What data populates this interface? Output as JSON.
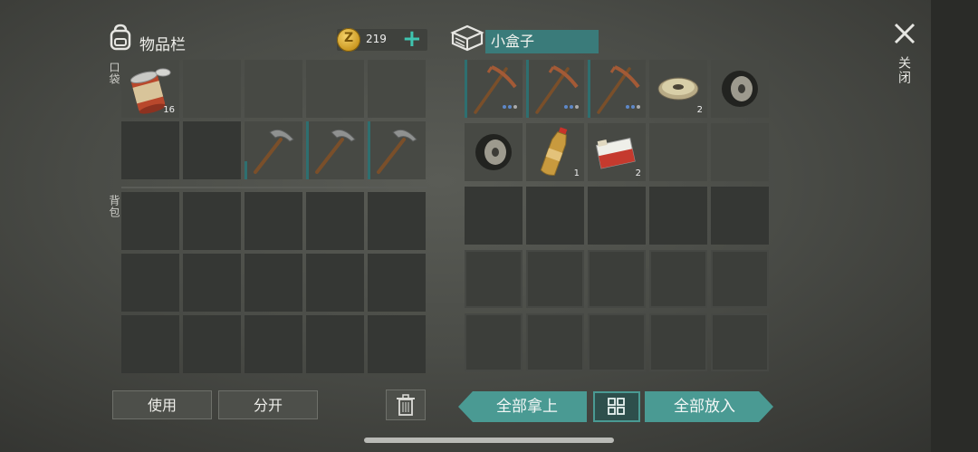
{
  "inventory": {
    "title": "物品栏",
    "pocket_label": "口袋",
    "backpack_label": "背包",
    "coins": "219",
    "coin_symbol": "Z",
    "add_coin": "+",
    "pocket_slots": [
      {
        "item": "canned-food",
        "qty": "16"
      },
      {
        "item": "empty"
      },
      {
        "item": "empty"
      },
      {
        "item": "empty"
      },
      {
        "item": "empty"
      },
      {
        "item": "empty"
      },
      {
        "item": "empty"
      },
      {
        "item": "pickaxe"
      },
      {
        "item": "pickaxe"
      },
      {
        "item": "pickaxe"
      }
    ]
  },
  "container": {
    "name": "小盒子",
    "slots_row1": [
      {
        "item": "copper-pickaxe"
      },
      {
        "item": "copper-pickaxe"
      },
      {
        "item": "copper-pickaxe"
      },
      {
        "item": "wire-spool",
        "qty": "2"
      },
      {
        "item": "tire-wheel"
      }
    ],
    "slots_row2": [
      {
        "item": "tire-wheel"
      },
      {
        "item": "soda-bottle",
        "qty": "1"
      },
      {
        "item": "cigarette-pack",
        "qty": "2"
      },
      {
        "item": "empty"
      },
      {
        "item": "empty"
      }
    ]
  },
  "buttons": {
    "use": "使用",
    "split": "分开",
    "take_all": "全部拿上",
    "put_all": "全部放入",
    "close": "关闭"
  },
  "colors": {
    "accent": "#4a9a93",
    "coin": "#d9a52c"
  }
}
